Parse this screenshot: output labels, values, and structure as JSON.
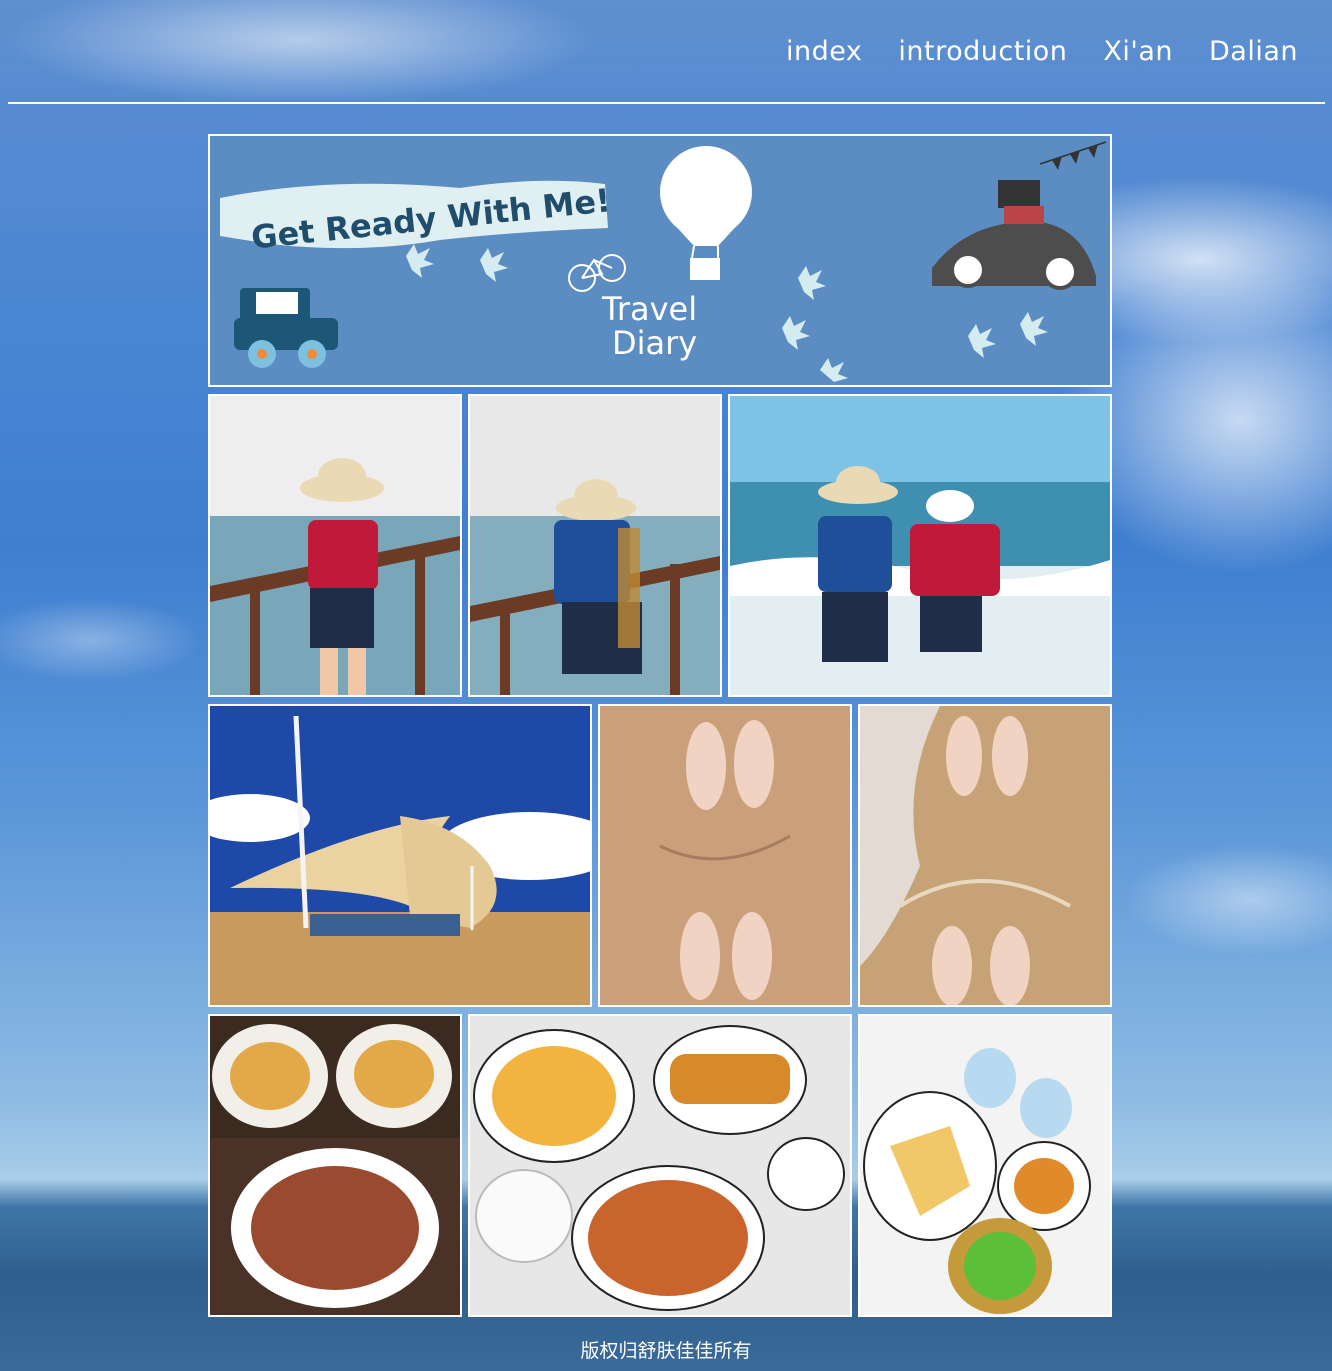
{
  "nav": {
    "items": [
      {
        "label": "index"
      },
      {
        "label": "introduction"
      },
      {
        "label": "Xi'an"
      },
      {
        "label": "Dalian"
      }
    ]
  },
  "banner": {
    "slogan": "Get Ready With Me!",
    "title_line1": "Travel",
    "title_line2": "Diary",
    "background_color": "#5b8dc3"
  },
  "footer": {
    "copyright": "版权归舒肤佳佳所有"
  },
  "colors": {
    "nav_text": "#ffffff",
    "rule": "#ffffff",
    "tile_border": "#ffffff"
  }
}
